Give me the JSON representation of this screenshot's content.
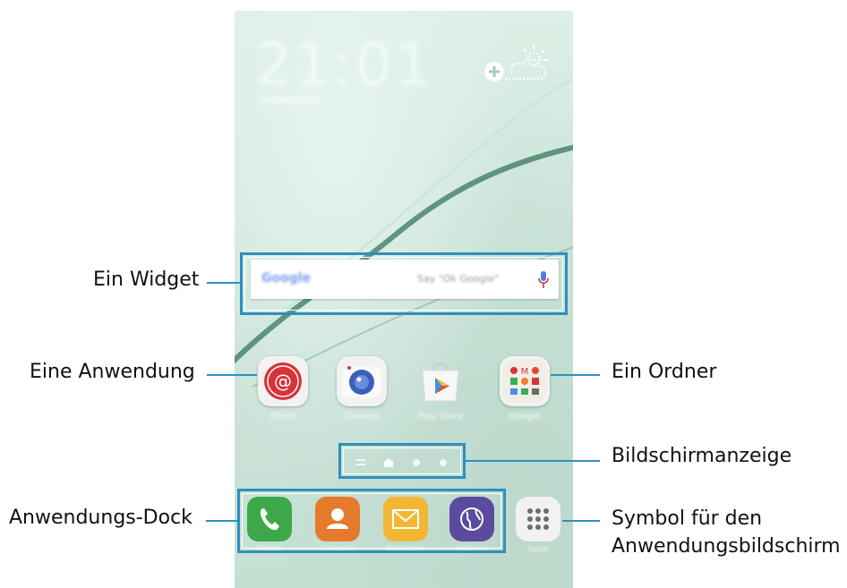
{
  "phone": {
    "clock_time": "21:01",
    "search_widget": {
      "logo": "Google",
      "hint": "Say \"Ok Google\""
    },
    "apps": [
      {
        "label": "Email",
        "icon": "email-icon"
      },
      {
        "label": "Camera",
        "icon": "camera-icon"
      },
      {
        "label": "Play Store",
        "icon": "play-store-icon"
      },
      {
        "label": "Google",
        "icon": "folder-icon"
      }
    ],
    "dock": [
      {
        "label": "Phone",
        "icon": "phone-icon"
      },
      {
        "label": "Contacts",
        "icon": "contacts-icon"
      },
      {
        "label": "Messages",
        "icon": "messages-icon"
      },
      {
        "label": "Internet",
        "icon": "internet-icon"
      }
    ],
    "apps_button_label": "Apps"
  },
  "labels": {
    "widget": "Ein Widget",
    "app": "Eine Anwendung",
    "folder": "Ein Ordner",
    "screen_indicator": "Bildschirmanzeige",
    "dock": "Anwendungs-Dock",
    "apps_icon_line1": "Symbol für den",
    "apps_icon_line2": "Anwendungsbildschirm"
  },
  "colors": {
    "callout": "#2f8fbf",
    "email": "#d9323a",
    "phone": "#3da84a",
    "contacts": "#e57a2c",
    "messages": "#f3b733",
    "internet": "#5c4a9e"
  }
}
